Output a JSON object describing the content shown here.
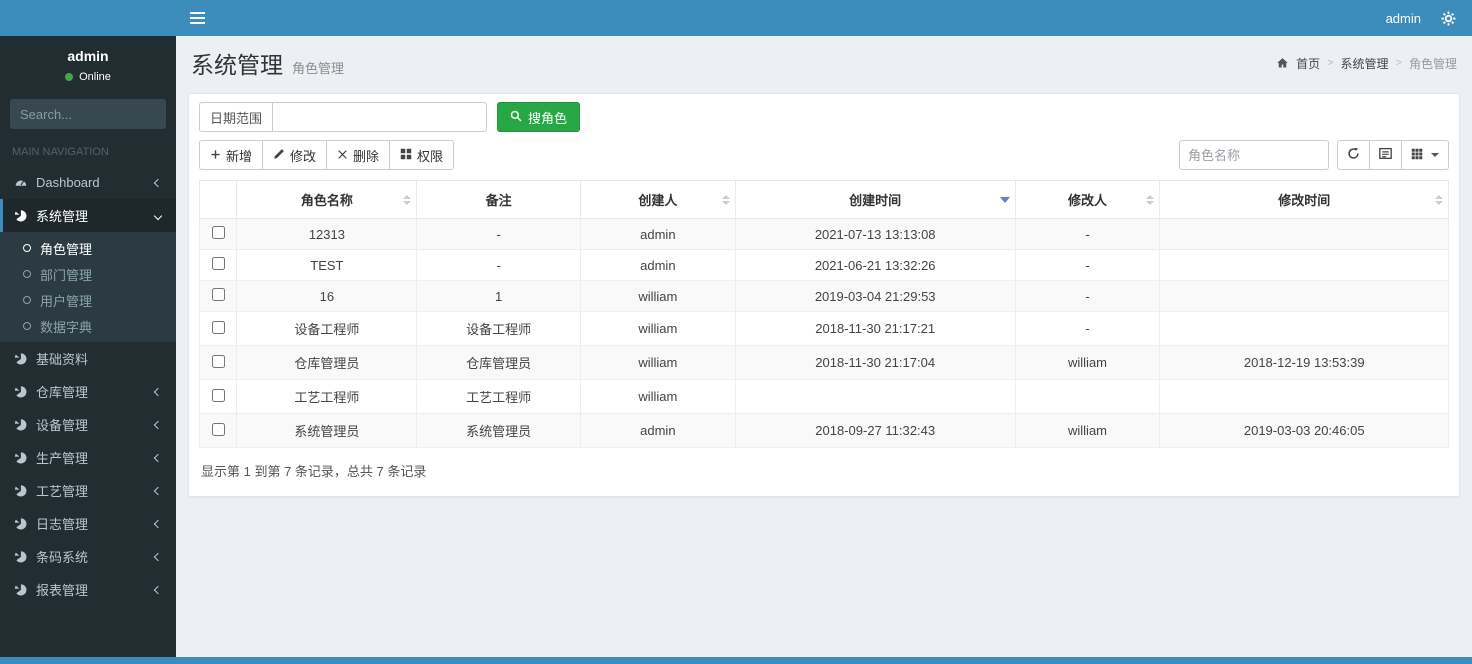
{
  "navbar": {
    "username": "admin",
    "hamburger_icon": "bars-icon",
    "settings_icon": "cogs-icon"
  },
  "sidebar": {
    "user": {
      "name": "admin",
      "status": "Online"
    },
    "search_placeholder": "Search...",
    "section_label": "MAIN NAVIGATION",
    "items": [
      {
        "label": "Dashboard",
        "icon": "dashboard-icon",
        "chevron": "left",
        "active": false
      },
      {
        "label": "系统管理",
        "icon": "pie-chart-icon",
        "chevron": "down",
        "active": true,
        "children": [
          {
            "label": "角色管理",
            "active": true
          },
          {
            "label": "部门管理",
            "active": false
          },
          {
            "label": "用户管理",
            "active": false
          },
          {
            "label": "数据字典",
            "active": false
          }
        ]
      },
      {
        "label": "基础资料",
        "icon": "pie-chart-icon",
        "chevron": null,
        "active": false
      },
      {
        "label": "仓库管理",
        "icon": "pie-chart-icon",
        "chevron": "left",
        "active": false
      },
      {
        "label": "设备管理",
        "icon": "pie-chart-icon",
        "chevron": "left",
        "active": false
      },
      {
        "label": "生产管理",
        "icon": "pie-chart-icon",
        "chevron": "left",
        "active": false
      },
      {
        "label": "工艺管理",
        "icon": "pie-chart-icon",
        "chevron": "left",
        "active": false
      },
      {
        "label": "日志管理",
        "icon": "pie-chart-icon",
        "chevron": "left",
        "active": false
      },
      {
        "label": "条码系统",
        "icon": "pie-chart-icon",
        "chevron": "left",
        "active": false
      },
      {
        "label": "报表管理",
        "icon": "pie-chart-icon",
        "chevron": "left",
        "active": false
      }
    ]
  },
  "header": {
    "title": "系统管理",
    "subtitle": "角色管理",
    "home_icon": "home-icon",
    "breadcrumb": [
      "首页",
      "系统管理",
      "角色管理"
    ]
  },
  "filters": {
    "date_label": "日期范围",
    "date_value": "",
    "search_button": "搜角色",
    "search_icon": "search-icon"
  },
  "toolbar": {
    "add": "新增",
    "add_icon": "plus-icon",
    "edit": "修改",
    "edit_icon": "pencil-icon",
    "delete": "删除",
    "delete_icon": "x-icon",
    "perm": "权限",
    "perm_icon": "th-large-icon",
    "name_placeholder": "角色名称",
    "refresh_icon": "refresh-icon",
    "toggle_icon": "list-icon",
    "columns_icon": "grid-icon"
  },
  "table": {
    "columns": [
      {
        "label": "",
        "sortable": false
      },
      {
        "label": "角色名称",
        "sortable": true
      },
      {
        "label": "备注",
        "sortable": false
      },
      {
        "label": "创建人",
        "sortable": true
      },
      {
        "label": "创建时间",
        "sortable": true,
        "sorted": "desc"
      },
      {
        "label": "修改人",
        "sortable": true
      },
      {
        "label": "修改时间",
        "sortable": true
      }
    ],
    "rows": [
      [
        "12313",
        "-",
        "admin",
        "2021-07-13 13:13:08",
        "-",
        ""
      ],
      [
        "TEST",
        "-",
        "admin",
        "2021-06-21 13:32:26",
        "-",
        ""
      ],
      [
        "16",
        "1",
        "william",
        "2019-03-04 21:29:53",
        "-",
        ""
      ],
      [
        "设备工程师",
        "设备工程师",
        "william",
        "2018-11-30 21:17:21",
        "-",
        ""
      ],
      [
        "仓库管理员",
        "仓库管理员",
        "william",
        "2018-11-30 21:17:04",
        "william",
        "2018-12-19 13:53:39"
      ],
      [
        "工艺工程师",
        "工艺工程师",
        "william",
        "",
        "",
        ""
      ],
      [
        "系统管理员",
        "系统管理员",
        "admin",
        "2018-09-27 11:32:43",
        "william",
        "2019-03-03 20:46:05"
      ]
    ],
    "summary": "显示第 1 到第 7 条记录，总共 7 条记录"
  },
  "colors": {
    "navbar": "#3c8dbc",
    "sidebar": "#222d32",
    "submenu_bg": "#2c3b41",
    "success_button": "#28a745",
    "active_sort_caret": "#6b79d8",
    "online_dot": "#41a844"
  }
}
